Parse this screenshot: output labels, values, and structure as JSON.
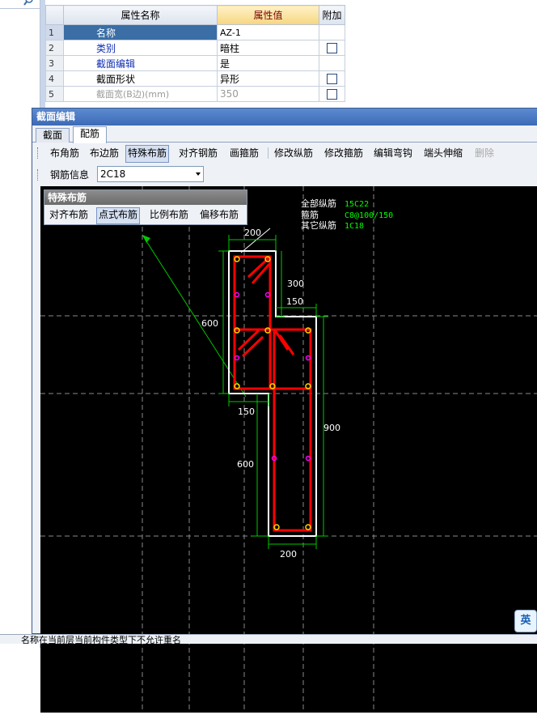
{
  "property_grid": {
    "headers": {
      "name": "属性名称",
      "value": "属性值",
      "extra": "附加"
    },
    "rows": [
      {
        "index": "1",
        "name": "名称",
        "value": "AZ-1",
        "checkbox": false,
        "name_style": "sel"
      },
      {
        "index": "2",
        "name": "类别",
        "value": "暗柱",
        "checkbox": true,
        "name_style": "blue"
      },
      {
        "index": "3",
        "name": "截面编辑",
        "value": "是",
        "checkbox": false,
        "name_style": "blue"
      },
      {
        "index": "4",
        "name": "截面形状",
        "value": "异形",
        "checkbox": true,
        "name_style": ""
      },
      {
        "index": "5",
        "name": "截面宽(B边)(mm)",
        "value": "350",
        "checkbox": true,
        "name_style": "gray"
      }
    ]
  },
  "dialog": {
    "title": "截面编辑",
    "tabs": [
      "截面",
      "配筋"
    ],
    "active_tab": "配筋",
    "toolbar": [
      "布角筋",
      "布边筋",
      "特殊布筋",
      "对齐钢筋",
      "画箍筋",
      "修改纵筋",
      "修改箍筋",
      "编辑弯钩",
      "端头伸缩",
      "删除"
    ],
    "toolbar_pressed": "特殊布筋",
    "toolbar_disabled": "删除",
    "rebar_info_label": "钢筋信息",
    "rebar_info_value": "2C18"
  },
  "special_rebar_bar": {
    "title": "特殊布筋",
    "buttons": [
      "对齐布筋",
      "点式布筋",
      "比例布筋",
      "偏移布筋"
    ],
    "pressed": "点式布筋"
  },
  "drawing": {
    "rebar_info": {
      "all_longitudinal_label": "全部纵筋",
      "all_longitudinal_value": "15C22",
      "stirrup_label": "箍筋",
      "stirrup_value": "C8@100/150",
      "other_longitudinal_label": "其它纵筋",
      "other_longitudinal_value": "1C18"
    },
    "dimensions": {
      "top_width": "200",
      "step_height": "300",
      "step_width": "150",
      "left_height": "600",
      "bottom_left_step": "150",
      "right_height": "900",
      "bottom_height": "600",
      "bottom_width": "200"
    },
    "colors": {
      "outline": "#ffffff",
      "rebar": "#ff0000",
      "dimension": "#00c800",
      "corner_bar": "#ffd800",
      "side_bar": "#ff00ff",
      "info_text": "#00ff00",
      "grid": "#8a8a8a"
    }
  },
  "status_bar": {
    "message": "名称在当前层当前构件类型下不允许重名"
  },
  "ime_indicator": "英"
}
